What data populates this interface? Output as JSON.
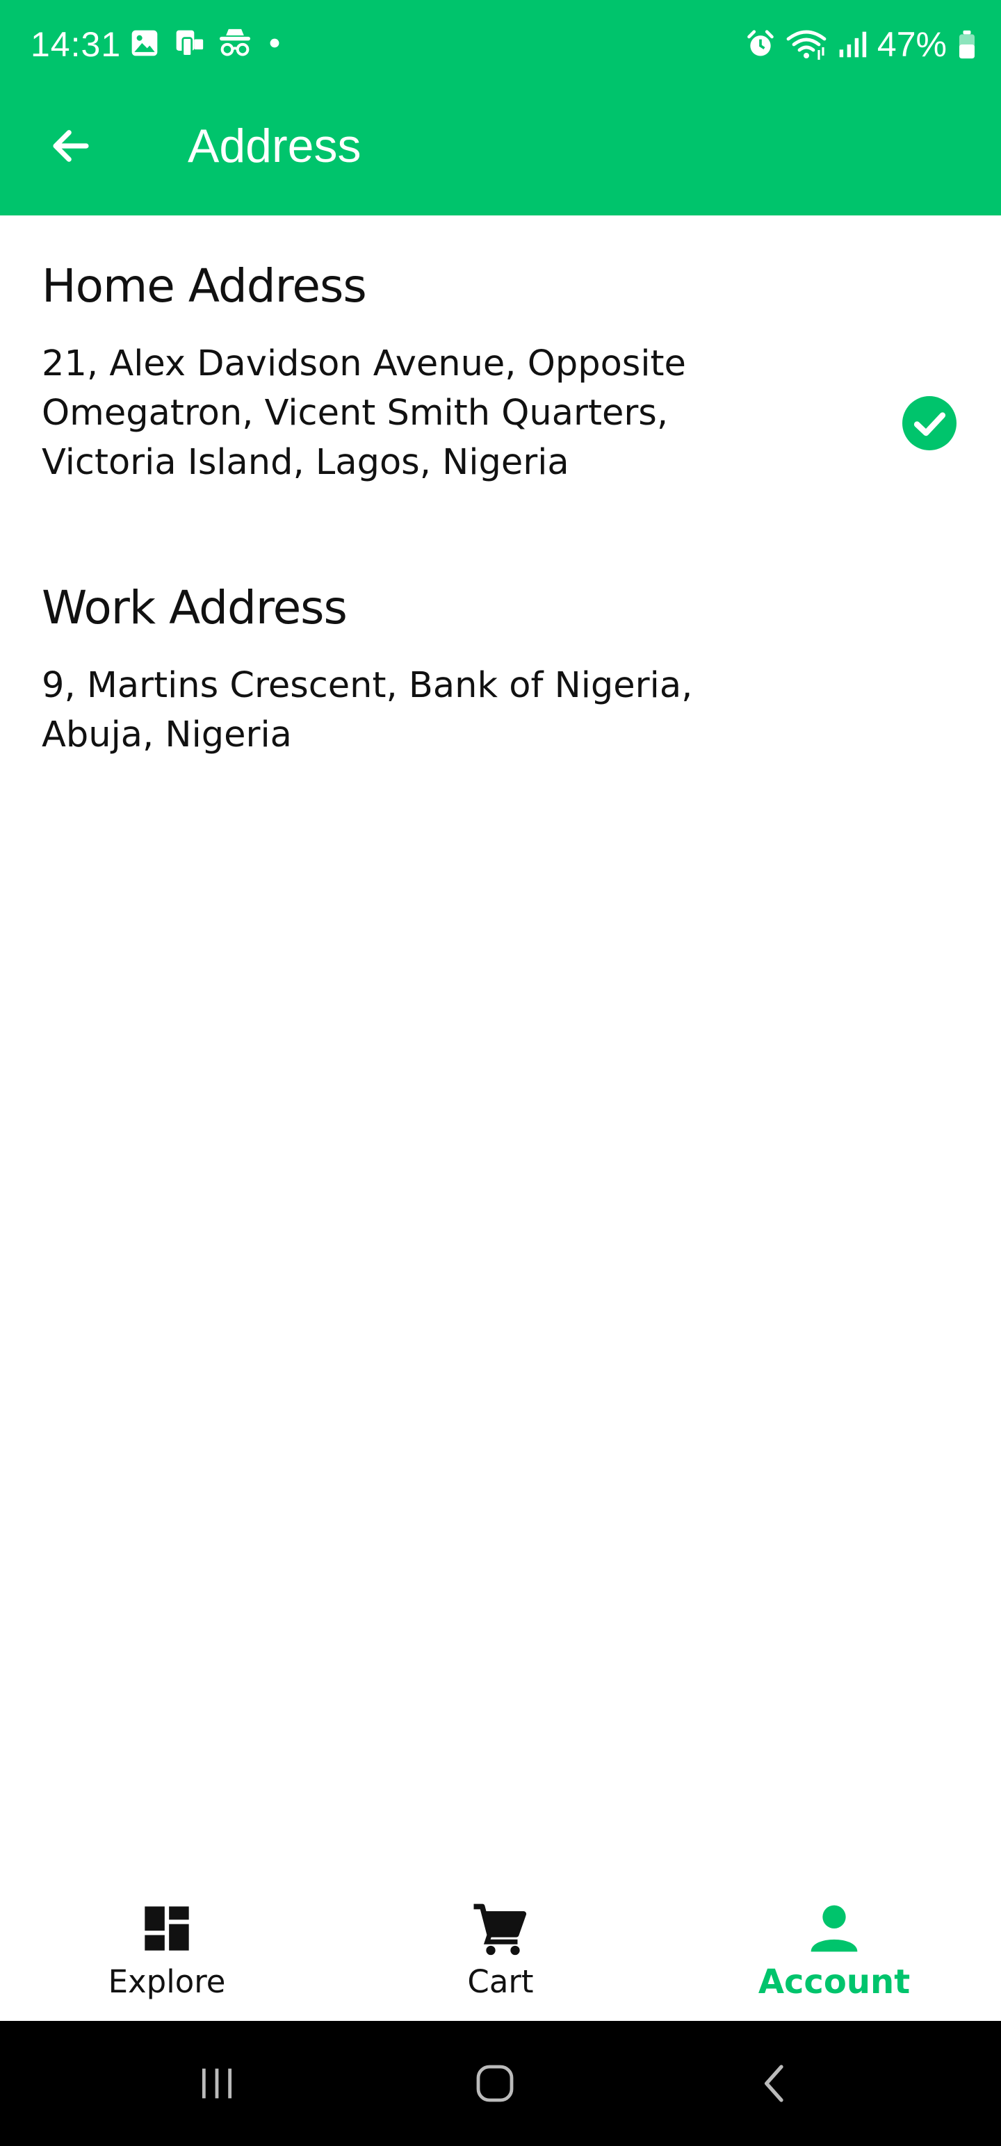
{
  "status_bar": {
    "time": "14:31",
    "battery": "47%"
  },
  "app_bar": {
    "title": "Address",
    "color": "#00c46c"
  },
  "addresses": [
    {
      "heading": "Home Address",
      "text": "21, Alex Davidson Avenue, Opposite Omegatron, Vicent Smith Quarters, Victoria Island, Lagos, Nigeria",
      "selected": true
    },
    {
      "heading": "Work Address",
      "text": "9, Martins Crescent, Bank of Nigeria, Abuja, Nigeria",
      "selected": false
    }
  ],
  "bottom_nav": {
    "items": [
      {
        "label": "Explore",
        "icon": "dashboard-icon"
      },
      {
        "label": "Cart",
        "icon": "cart-icon"
      },
      {
        "label": "Account",
        "icon": "person-icon",
        "active": true
      }
    ]
  },
  "system_nav": [
    "recents-icon",
    "home-icon",
    "back-icon"
  ]
}
